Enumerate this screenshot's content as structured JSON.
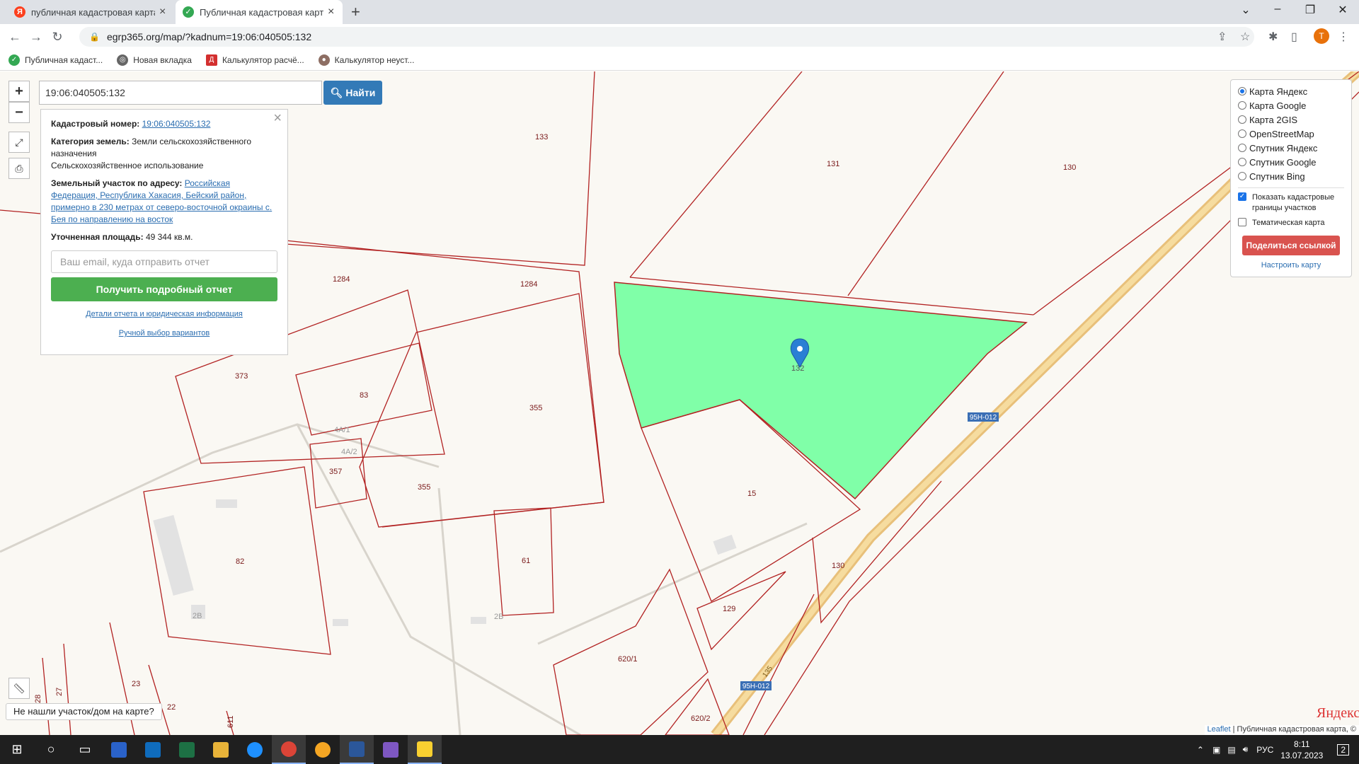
{
  "browser": {
    "tabs": [
      {
        "title": "публичная кадастровая карта р",
        "icon": "yandex-icon"
      },
      {
        "title": "Публичная кадастровая карта Х",
        "icon": "check-circle-icon"
      }
    ],
    "url": "egrp365.org/map/?kadnum=19:06:040505:132",
    "profile_initial": "Т",
    "bookmarks": [
      "Публичная кадаст...",
      "Новая вкладка",
      "Калькулятор расчё...",
      "Калькулятор неуст..."
    ]
  },
  "map": {
    "search_value": "19:06:040505:132",
    "find_label": "Найти",
    "info": {
      "cadnum_label": "Кадастровый номер:",
      "cadnum_value": "19:06:040505:132",
      "category_label": "Категория земель:",
      "category_value": "Земли сельскохозяйственного назначения",
      "use_value": "Сельскохозяйственное использование",
      "address_label": "Земельный участок по адресу:",
      "address_value": "Российская Федерация, Республика Хакасия, Бейский район, примерно в 230 метрах от северо-восточной окраины с. Бея по направлению на восток",
      "area_label": "Уточненная площадь:",
      "area_value": "49 344 кв.м.",
      "email_placeholder": "Ваш email, куда отправить отчет",
      "report_button": "Получить подробный отчет",
      "details_link": "Детали отчета и юридическая информация",
      "manual_link": "Ручной выбор вариантов"
    },
    "layers": {
      "options": [
        "Карта Яндекс",
        "Карта Google",
        "Карта 2GIS",
        "OpenStreetMap",
        "Спутник Яндекс",
        "Спутник Google",
        "Спутник Bing"
      ],
      "selected": "Карта Яндекс",
      "show_borders": "Показать кадастровые границы участков",
      "thematic": "Тематическая карта",
      "share_button": "Поделиться ссылкой",
      "configure_link": "Настроить карту"
    },
    "parcel_labels": [
      "133",
      "131",
      "130",
      "1284",
      "1284",
      "373",
      "83",
      "355",
      "4А/1",
      "4А/2",
      "357",
      "355",
      "82",
      "61",
      "2В",
      "2Б",
      "15",
      "129",
      "130",
      "620/1",
      "620/2",
      "23",
      "22",
      "28",
      "27",
      "611",
      "132"
    ],
    "road_labels": [
      "95Н-012",
      "95Н-012",
      "135"
    ],
    "not_found": "Не нашли участок/дом на карте?",
    "attribution_leaflet": "Leaflet",
    "attribution_text": "Публичная кадастровая карта, ©",
    "yandex_logo": "Яндекс",
    "selected_fill": "#80ffa8",
    "border_color": "#b22222"
  },
  "taskbar": {
    "lang": "РУС",
    "time": "8:11",
    "date": "13.07.2023",
    "notifications": "2"
  }
}
